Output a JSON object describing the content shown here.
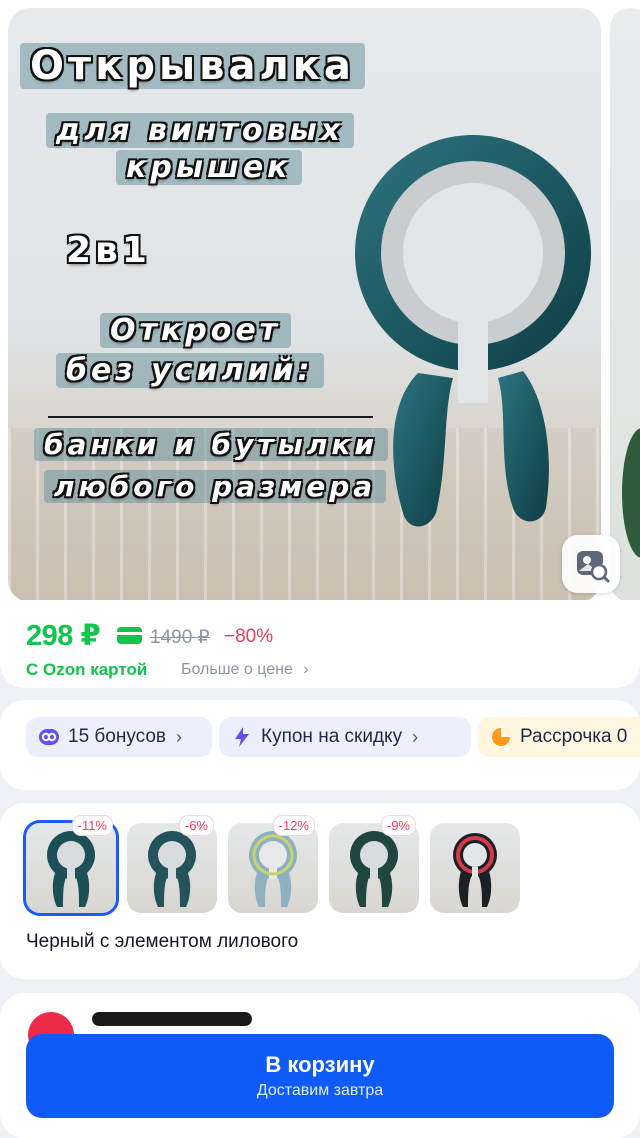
{
  "product": {
    "image_text": {
      "title": "Открывалка",
      "line2": "для винтовых",
      "line3": "крышек",
      "badge": "2в1",
      "line5": "Откроет",
      "line6": "без усилий:",
      "line7": "банки и бутылки",
      "line8": "любого размера"
    },
    "image_search_icon": "image-search-icon"
  },
  "price": {
    "current": "298 ₽",
    "old": "1490 ₽",
    "discount": "−80%",
    "card_label": "С Ozon картой",
    "more_label": "Больше о цене",
    "accent": "#10c44c",
    "discount_color": "#f33b5b"
  },
  "chips": [
    {
      "label": "15 бонусов",
      "icon": "bonus-icon"
    },
    {
      "label": "Купон на скидку",
      "icon": "lightning-icon"
    },
    {
      "label": "Рассрочка 0",
      "icon": "pie-icon"
    }
  ],
  "variants": {
    "items": [
      {
        "badge": "-11%",
        "ring": "#2a4a52",
        "body": "#1d4f57",
        "selected": true
      },
      {
        "badge": "-6%",
        "ring": "#2f5258",
        "body": "#24535b"
      },
      {
        "badge": "-12%",
        "ring": "#9fb8c2",
        "body": "#8fb0c0"
      },
      {
        "badge": "-9%",
        "ring": "#2f4a40",
        "body": "#21463f"
      },
      {
        "badge": "",
        "ring": "#d63a4a",
        "body": "#1b2024"
      }
    ],
    "selected_name": "Черный с элементом лилового"
  },
  "cart": {
    "label": "В корзину",
    "sub": "Доставим завтра",
    "color": "#0e5bf7"
  }
}
